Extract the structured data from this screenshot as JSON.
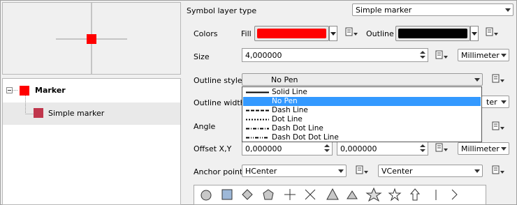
{
  "preview": {
    "marker_color": "#ff0000"
  },
  "tree": {
    "items": [
      {
        "label": "Marker",
        "color": "#ff0000"
      },
      {
        "label": "Simple marker",
        "color": "#c0364c"
      }
    ]
  },
  "form": {
    "layer_type_label": "Symbol layer type",
    "layer_type_value": "Simple marker",
    "colors_label": "Colors",
    "fill_label": "Fill",
    "fill_color": "#ff0000",
    "outline_label": "Outline",
    "outline_color": "#000000",
    "size_label": "Size",
    "size_value": "4,000000",
    "size_unit": "Millimeter",
    "outline_style_label": "Outline style",
    "outline_style_value": "No Pen",
    "outline_width_label": "Outline width",
    "outline_width_unit_tail": "ter",
    "angle_label": "Angle",
    "offset_label": "Offset X,Y",
    "offset_x": "0,000000",
    "offset_y": "0,000000",
    "offset_unit": "Millimeter",
    "anchor_label": "Anchor point",
    "anchor_h": "HCenter",
    "anchor_v": "VCenter"
  },
  "outline_style_options": [
    {
      "label": "Solid Line",
      "pattern": "solid",
      "selected": false
    },
    {
      "label": "No Pen",
      "pattern": "none",
      "selected": true
    },
    {
      "label": "Dash Line",
      "pattern": "dash",
      "selected": false
    },
    {
      "label": "Dot Line",
      "pattern": "dot",
      "selected": false
    },
    {
      "label": "Dash Dot Line",
      "pattern": "dashdot",
      "selected": false
    },
    {
      "label": "Dash Dot Dot Line",
      "pattern": "dashdotdot",
      "selected": false
    }
  ],
  "symbols": [
    "circle-icon",
    "square-icon",
    "diamond-icon",
    "pentagon-icon",
    "cross-icon",
    "x-icon",
    "triangle-icon",
    "equilateral-triangle-icon",
    "star-icon",
    "regular-star-icon",
    "arrow-icon",
    "line-icon",
    "arrowhead-icon"
  ]
}
